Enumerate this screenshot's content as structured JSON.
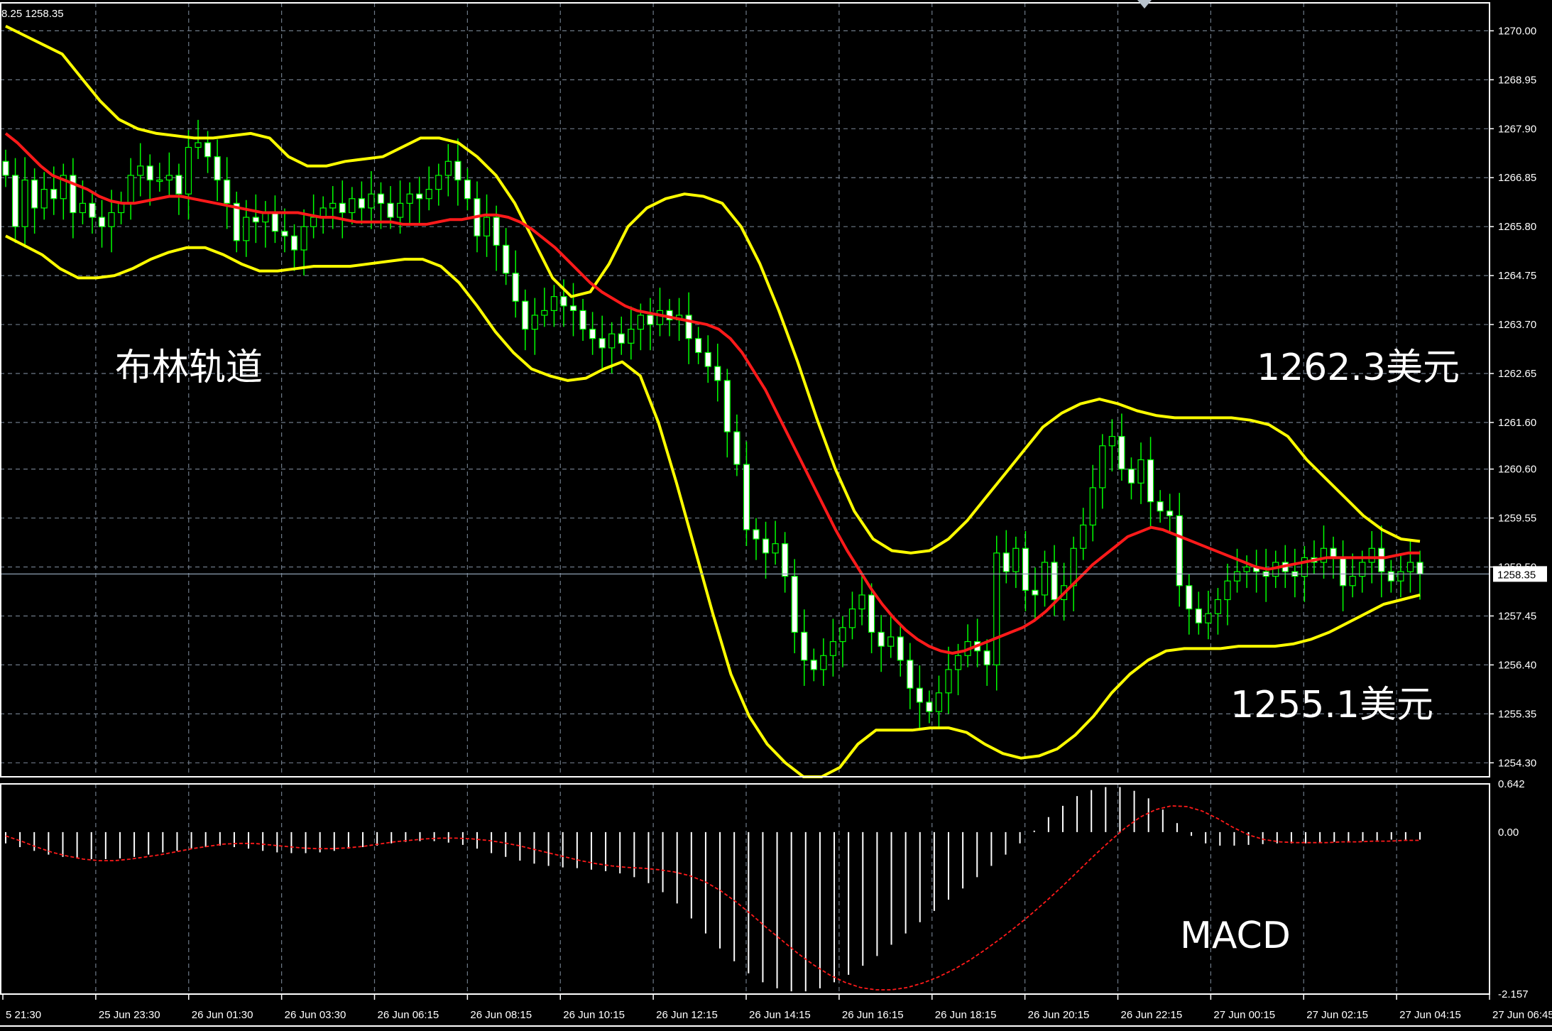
{
  "header": {
    "readout": "8.25 1258.35"
  },
  "annotations": {
    "bollinger": "布林轨道",
    "upper_price": "1262.3美元",
    "lower_price": "1255.1美元",
    "macd": "MACD"
  },
  "current_price": {
    "label": "1258.35",
    "value": 1258.35
  },
  "colors": {
    "background": "#000000",
    "grid": "#6e7a88",
    "frame": "#ffffff",
    "bull_candle": "#00ff00",
    "bear_candle": "#ffffff",
    "bollinger_band": "#ffff00",
    "middle_ma": "#ff1a1a",
    "macd_histogram": "#ffffff",
    "macd_signal": "#ff1a1a",
    "price_line": "#8ea0b4"
  },
  "chart_data": [
    {
      "type": "candlestick",
      "title": "",
      "xlabel": "",
      "ylabel": "",
      "ylim": [
        1254.0,
        1270.6
      ],
      "grid": true,
      "y_ticks": [
        "1270.00",
        "1268.95",
        "1267.90",
        "1266.85",
        "1265.80",
        "1264.75",
        "1263.70",
        "1262.65",
        "1261.60",
        "1260.60",
        "1259.55",
        "1258.50",
        "1257.45",
        "1256.40",
        "1255.35",
        "1254.30"
      ],
      "y_tick_values": [
        1270.0,
        1268.95,
        1267.9,
        1266.85,
        1265.8,
        1264.75,
        1263.7,
        1262.65,
        1261.6,
        1260.6,
        1259.55,
        1258.5,
        1257.45,
        1256.4,
        1255.35,
        1254.3
      ],
      "x_ticks": [
        "5 21:30",
        "25 Jun 23:30",
        "26 Jun 01:30",
        "26 Jun 03:30",
        "26 Jun 06:15",
        "26 Jun 08:15",
        "26 Jun 10:15",
        "26 Jun 12:15",
        "26 Jun 14:15",
        "26 Jun 16:15",
        "26 Jun 18:15",
        "26 Jun 20:15",
        "26 Jun 22:15",
        "27 Jun 00:15",
        "27 Jun 02:15",
        "27 Jun 04:15",
        "27 Jun 06:45"
      ],
      "closes": [
        1266.9,
        1265.8,
        1266.8,
        1266.2,
        1266.6,
        1266.4,
        1266.9,
        1266.1,
        1266.3,
        1266.0,
        1265.8,
        1266.1,
        1266.3,
        1266.9,
        1267.1,
        1266.8,
        1266.8,
        1266.9,
        1266.5,
        1267.5,
        1267.6,
        1267.3,
        1266.8,
        1266.3,
        1265.5,
        1266.0,
        1265.9,
        1266.1,
        1265.7,
        1265.6,
        1265.3,
        1265.8,
        1266.0,
        1266.2,
        1266.3,
        1266.1,
        1266.4,
        1266.2,
        1266.5,
        1266.3,
        1266.0,
        1266.3,
        1266.5,
        1266.4,
        1266.6,
        1266.9,
        1267.2,
        1266.8,
        1266.4,
        1265.6,
        1266.0,
        1265.4,
        1264.8,
        1264.2,
        1263.6,
        1263.9,
        1264.0,
        1264.3,
        1264.1,
        1264.0,
        1263.6,
        1263.4,
        1263.2,
        1263.5,
        1263.3,
        1263.6,
        1263.9,
        1263.7,
        1264.0,
        1263.8,
        1263.9,
        1263.4,
        1263.1,
        1262.8,
        1262.5,
        1261.4,
        1260.7,
        1259.3,
        1259.1,
        1258.8,
        1259.0,
        1258.3,
        1257.1,
        1256.5,
        1256.3,
        1256.6,
        1256.9,
        1257.2,
        1257.6,
        1257.9,
        1257.1,
        1256.8,
        1257.0,
        1256.5,
        1255.9,
        1255.6,
        1255.4,
        1255.8,
        1256.3,
        1256.6,
        1256.9,
        1256.7,
        1256.4,
        1258.8,
        1258.4,
        1258.9,
        1258.0,
        1257.9,
        1258.6,
        1257.8,
        1258.1,
        1258.9,
        1259.4,
        1260.2,
        1261.1,
        1261.3,
        1260.6,
        1260.3,
        1260.8,
        1259.9,
        1259.7,
        1259.6,
        1258.1,
        1257.6,
        1257.3,
        1257.5,
        1257.8,
        1258.2,
        1258.4,
        1258.5,
        1258.4,
        1258.3,
        1258.6,
        1258.4,
        1258.3,
        1258.7,
        1258.6,
        1258.9,
        1258.7,
        1258.1,
        1258.3,
        1258.6,
        1258.9,
        1258.4,
        1258.2,
        1258.4,
        1258.6,
        1258.35
      ],
      "middle_band": [
        1267.8,
        1267.6,
        1267.35,
        1267.1,
        1266.9,
        1266.8,
        1266.7,
        1266.6,
        1266.45,
        1266.35,
        1266.3,
        1266.3,
        1266.35,
        1266.4,
        1266.45,
        1266.45,
        1266.4,
        1266.35,
        1266.3,
        1266.25,
        1266.2,
        1266.15,
        1266.1,
        1266.1,
        1266.1,
        1266.1,
        1266.05,
        1266.0,
        1266.0,
        1265.95,
        1265.9,
        1265.9,
        1265.9,
        1265.9,
        1265.85,
        1265.85,
        1265.85,
        1265.9,
        1265.95,
        1265.95,
        1266.0,
        1266.05,
        1266.05,
        1266.0,
        1265.9,
        1265.75,
        1265.55,
        1265.35,
        1265.1,
        1264.85,
        1264.6,
        1264.4,
        1264.25,
        1264.1,
        1264.0,
        1263.95,
        1263.9,
        1263.85,
        1263.8,
        1263.75,
        1263.7,
        1263.6,
        1263.4,
        1263.1,
        1262.7,
        1262.3,
        1261.8,
        1261.3,
        1260.8,
        1260.3,
        1259.8,
        1259.3,
        1258.85,
        1258.45,
        1258.05,
        1257.7,
        1257.4,
        1257.15,
        1256.95,
        1256.8,
        1256.7,
        1256.65,
        1256.7,
        1256.8,
        1256.9,
        1257.0,
        1257.1,
        1257.2,
        1257.35,
        1257.55,
        1257.8,
        1258.05,
        1258.3,
        1258.55,
        1258.75,
        1258.95,
        1259.15,
        1259.25,
        1259.35,
        1259.3,
        1259.2,
        1259.1,
        1259.0,
        1258.9,
        1258.8,
        1258.7,
        1258.6,
        1258.5,
        1258.45,
        1258.5,
        1258.55,
        1258.6,
        1258.65,
        1258.7,
        1258.7,
        1258.7,
        1258.7,
        1258.7,
        1258.7,
        1258.75,
        1258.8,
        1258.8
      ],
      "upper_band": [
        1270.1,
        1269.9,
        1269.7,
        1269.5,
        1269.0,
        1268.5,
        1268.1,
        1267.9,
        1267.8,
        1267.75,
        1267.7,
        1267.7,
        1267.75,
        1267.8,
        1267.7,
        1267.3,
        1267.1,
        1267.1,
        1267.2,
        1267.25,
        1267.3,
        1267.5,
        1267.7,
        1267.7,
        1267.6,
        1267.3,
        1266.9,
        1266.3,
        1265.5,
        1264.7,
        1264.3,
        1264.4,
        1265.0,
        1265.8,
        1266.2,
        1266.4,
        1266.5,
        1266.45,
        1266.3,
        1265.8,
        1265.0,
        1264.0,
        1262.9,
        1261.7,
        1260.6,
        1259.7,
        1259.1,
        1258.85,
        1258.8,
        1258.85,
        1259.1,
        1259.5,
        1260.0,
        1260.5,
        1261.0,
        1261.5,
        1261.8,
        1262.0,
        1262.1,
        1262.0,
        1261.85,
        1261.75,
        1261.7,
        1261.7,
        1261.7,
        1261.7,
        1261.65,
        1261.55,
        1261.3,
        1260.8,
        1260.4,
        1260.0,
        1259.6,
        1259.3,
        1259.1,
        1259.05
      ],
      "lower_band": [
        1265.6,
        1265.4,
        1265.2,
        1264.9,
        1264.7,
        1264.7,
        1264.75,
        1264.9,
        1265.1,
        1265.25,
        1265.35,
        1265.35,
        1265.2,
        1265.0,
        1264.85,
        1264.85,
        1264.9,
        1264.95,
        1264.95,
        1264.95,
        1265.0,
        1265.05,
        1265.1,
        1265.1,
        1264.95,
        1264.6,
        1264.1,
        1263.55,
        1263.1,
        1262.75,
        1262.6,
        1262.5,
        1262.55,
        1262.75,
        1262.9,
        1262.6,
        1261.6,
        1260.3,
        1258.9,
        1257.5,
        1256.2,
        1255.3,
        1254.7,
        1254.3,
        1254.0,
        1254.0,
        1254.2,
        1254.7,
        1255.0,
        1255.0,
        1255.0,
        1255.05,
        1255.05,
        1254.95,
        1254.7,
        1254.5,
        1254.4,
        1254.45,
        1254.6,
        1254.9,
        1255.3,
        1255.8,
        1256.2,
        1256.5,
        1256.7,
        1256.75,
        1256.75,
        1256.75,
        1256.8,
        1256.8,
        1256.8,
        1256.85,
        1256.95,
        1257.1,
        1257.3,
        1257.5,
        1257.7,
        1257.8,
        1257.9
      ]
    },
    {
      "type": "bar",
      "title": "",
      "y_ticks": [
        "0.642",
        "0.00",
        "-2.157"
      ],
      "y_tick_values": [
        0.642,
        0.0,
        -2.157
      ],
      "ylim": [
        -2.157,
        0.642
      ],
      "histogram": [
        -0.15,
        -0.2,
        -0.25,
        -0.3,
        -0.33,
        -0.35,
        -0.36,
        -0.36,
        -0.35,
        -0.33,
        -0.3,
        -0.27,
        -0.25,
        -0.22,
        -0.2,
        -0.18,
        -0.2,
        -0.22,
        -0.25,
        -0.27,
        -0.28,
        -0.28,
        -0.27,
        -0.25,
        -0.22,
        -0.2,
        -0.18,
        -0.15,
        -0.13,
        -0.12,
        -0.12,
        -0.14,
        -0.17,
        -0.22,
        -0.28,
        -0.33,
        -0.38,
        -0.42,
        -0.45,
        -0.47,
        -0.48,
        -0.5,
        -0.52,
        -0.55,
        -0.6,
        -0.68,
        -0.8,
        -0.95,
        -1.15,
        -1.35,
        -1.55,
        -1.72,
        -1.88,
        -2.0,
        -2.08,
        -2.12,
        -2.12,
        -2.08,
        -2.0,
        -1.9,
        -1.78,
        -1.65,
        -1.5,
        -1.35,
        -1.2,
        -1.05,
        -0.9,
        -0.75,
        -0.6,
        -0.45,
        -0.3,
        -0.15,
        0.02,
        0.2,
        0.35,
        0.48,
        0.56,
        0.6,
        0.6,
        0.55,
        0.45,
        0.3,
        0.12,
        -0.05,
        -0.15,
        -0.18,
        -0.18,
        -0.17,
        -0.16,
        -0.15,
        -0.15,
        -0.15,
        -0.14,
        -0.13,
        -0.12,
        -0.12,
        -0.11,
        -0.1,
        -0.1,
        -0.1
      ],
      "signal": [
        -0.05,
        -0.12,
        -0.2,
        -0.27,
        -0.32,
        -0.36,
        -0.38,
        -0.38,
        -0.36,
        -0.33,
        -0.3,
        -0.26,
        -0.22,
        -0.19,
        -0.16,
        -0.15,
        -0.15,
        -0.17,
        -0.19,
        -0.21,
        -0.22,
        -0.22,
        -0.21,
        -0.19,
        -0.16,
        -0.13,
        -0.11,
        -0.09,
        -0.08,
        -0.08,
        -0.09,
        -0.11,
        -0.14,
        -0.18,
        -0.23,
        -0.28,
        -0.33,
        -0.38,
        -0.42,
        -0.45,
        -0.47,
        -0.48,
        -0.5,
        -0.53,
        -0.58,
        -0.66,
        -0.78,
        -0.93,
        -1.1,
        -1.28,
        -1.45,
        -1.62,
        -1.77,
        -1.9,
        -2.0,
        -2.07,
        -2.1,
        -2.1,
        -2.07,
        -2.01,
        -1.93,
        -1.83,
        -1.71,
        -1.57,
        -1.42,
        -1.26,
        -1.09,
        -0.91,
        -0.72,
        -0.52,
        -0.32,
        -0.13,
        0.05,
        0.2,
        0.3,
        0.35,
        0.34,
        0.28,
        0.18,
        0.06,
        -0.04,
        -0.1,
        -0.13,
        -0.14,
        -0.14,
        -0.14,
        -0.13,
        -0.13,
        -0.12,
        -0.12,
        -0.11,
        -0.11
      ]
    }
  ]
}
